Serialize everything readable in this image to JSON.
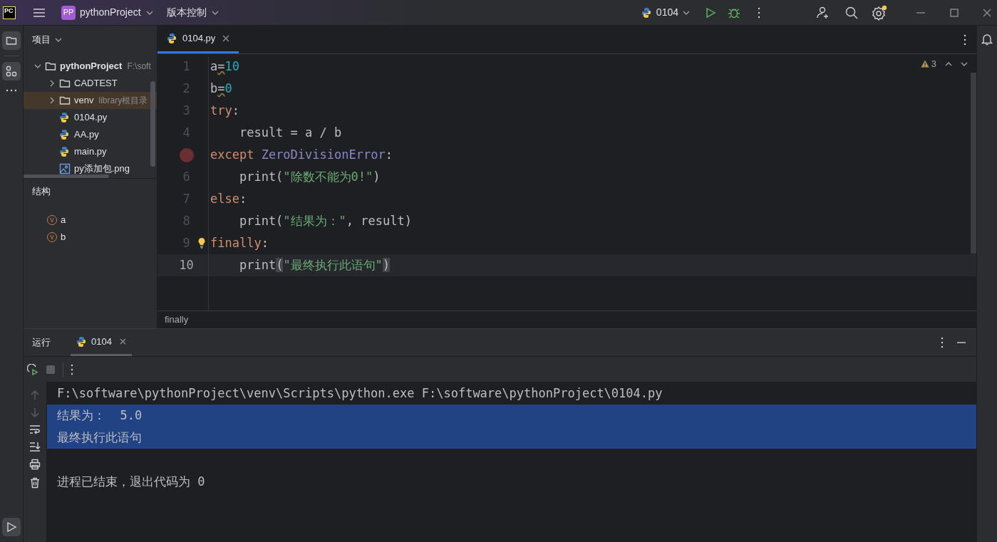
{
  "title_bar": {
    "logo": "PC",
    "project_badge": "PP",
    "project": "pythonProject",
    "vcs": "版本控制",
    "run_config": "0104"
  },
  "project_panel": {
    "title": "项目",
    "tree": [
      {
        "label": "pythonProject",
        "hint": "F:\\soft",
        "kind": "folder",
        "expanded": true,
        "selected": false,
        "children": [
          {
            "label": "CADTEST",
            "kind": "folder",
            "expanded": false,
            "selected": false
          },
          {
            "label": "venv",
            "hint": "library根目录",
            "kind": "folder",
            "expanded": false,
            "selected": true
          },
          {
            "label": "0104.py",
            "kind": "python",
            "selected": false
          },
          {
            "label": "AA.py",
            "kind": "python",
            "selected": false
          },
          {
            "label": "main.py",
            "kind": "python",
            "selected": false
          },
          {
            "label": "py添加包.png",
            "kind": "image",
            "selected": false
          }
        ]
      }
    ]
  },
  "structure": {
    "title": "结构",
    "items": [
      {
        "badge": "v",
        "label": "a"
      },
      {
        "badge": "v",
        "label": "b"
      }
    ]
  },
  "editor": {
    "tabs": [
      {
        "label": "0104.py",
        "selected": true
      }
    ],
    "warnings": "3",
    "lines": [
      {
        "number": "1",
        "breakpoint": false,
        "current": false,
        "tokens": [
          {
            "text": "a",
            "kind": "plain"
          },
          {
            "text": "=",
            "kind": "warn"
          },
          {
            "text": "10",
            "kind": "number"
          }
        ]
      },
      {
        "number": "2",
        "breakpoint": false,
        "current": false,
        "tokens": [
          {
            "text": "b",
            "kind": "plain"
          },
          {
            "text": "=",
            "kind": "warn"
          },
          {
            "text": "0",
            "kind": "number"
          }
        ]
      },
      {
        "number": "3",
        "breakpoint": false,
        "current": false,
        "tokens": [
          {
            "text": "try",
            "kind": "keyword"
          },
          {
            "text": ":",
            "kind": "plain"
          }
        ]
      },
      {
        "number": "4",
        "breakpoint": false,
        "current": false,
        "tokens": [
          {
            "text": "    result = a / b",
            "kind": "plain"
          }
        ]
      },
      {
        "breakpoint": true,
        "current": false,
        "tokens": [
          {
            "text": "except ",
            "kind": "keyword"
          },
          {
            "text": "ZeroDivisionError",
            "kind": "class"
          },
          {
            "text": ":",
            "kind": "plain"
          }
        ]
      },
      {
        "number": "6",
        "breakpoint": false,
        "current": false,
        "tokens": [
          {
            "text": "    print(",
            "kind": "plain"
          },
          {
            "text": "\"除数不能为0!\"",
            "kind": "string"
          },
          {
            "text": ")",
            "kind": "plain"
          }
        ]
      },
      {
        "number": "7",
        "breakpoint": false,
        "current": false,
        "tokens": [
          {
            "text": "else",
            "kind": "keyword"
          },
          {
            "text": ":",
            "kind": "plain"
          }
        ]
      },
      {
        "number": "8",
        "breakpoint": false,
        "current": false,
        "tokens": [
          {
            "text": "    print(",
            "kind": "plain"
          },
          {
            "text": "\"结果为：\"",
            "kind": "string"
          },
          {
            "text": ", result)",
            "kind": "plain"
          }
        ]
      },
      {
        "number": "9",
        "breakpoint": false,
        "current": false,
        "tokens": [
          {
            "text": "finally",
            "kind": "keyword"
          },
          {
            "text": ":",
            "kind": "plain"
          }
        ]
      },
      {
        "number": "10",
        "breakpoint": false,
        "current": true,
        "tokens": [
          {
            "text": "    print",
            "kind": "plain"
          },
          {
            "text": "(",
            "kind": "match"
          },
          {
            "text": "\"最终执行此语句\"",
            "kind": "string"
          },
          {
            "text": ")",
            "kind": "match"
          }
        ]
      }
    ],
    "breadcrumb": "finally"
  },
  "run_panel": {
    "title": "运行",
    "tabs": [
      {
        "label": "0104",
        "selected": true
      }
    ],
    "output": [
      {
        "text": "F:\\software\\pythonProject\\venv\\Scripts\\python.exe F:\\software\\pythonProject\\0104.py",
        "selected": false
      },
      {
        "text": "结果为：  5.0",
        "selected": true
      },
      {
        "text": "最终执行此语句",
        "selected": true
      }
    ],
    "exit_message": "进程已结束，退出代码为 0"
  }
}
